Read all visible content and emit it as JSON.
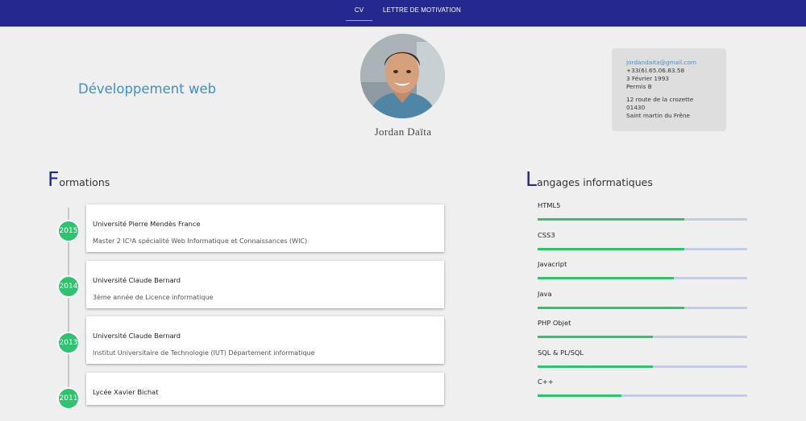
{
  "nav": {
    "cv_label": "CV",
    "lettre_label": "LETTRE DE MOTIVATION"
  },
  "header": {
    "headline": "Développement web",
    "name": "Jordan Daïta"
  },
  "contact": {
    "email": "jordandaita@gmail.com",
    "phone": "+33(6).65.06.83.58",
    "birthdate": "3 Février 1993",
    "license": "Permis B",
    "address_street": "12 route de la crozette",
    "address_zip": "01430",
    "address_city": "Saint martin du Frêne"
  },
  "formations": {
    "title_first": "F",
    "title_rest": "ormations",
    "items": [
      {
        "year": "2015",
        "school": "Université Pierre Mendès France",
        "degree": "Master 2 IC²A spécialité Web Informatique et Connaissances (WIC)"
      },
      {
        "year": "2014",
        "school": "Université Claude Bernard",
        "degree": "3ème année de Licence informatique"
      },
      {
        "year": "2013",
        "school": "Université Claude Bernard",
        "degree": "Institut Universitaire de Technologie (IUT) Département informatique"
      },
      {
        "year": "2011",
        "school": "Lycée Xavier Bichat",
        "degree": ""
      }
    ]
  },
  "langages": {
    "title_first": "L",
    "title_rest": "angages informatiques",
    "items": [
      {
        "label": "HTML5",
        "level": 0.7
      },
      {
        "label": "CSS3",
        "level": 0.7
      },
      {
        "label": "Javacript",
        "level": 0.65
      },
      {
        "label": "Java",
        "level": 0.7
      },
      {
        "label": "PHP Objet",
        "level": 0.55
      },
      {
        "label": "SQL & PL/SQL",
        "level": 0.55
      },
      {
        "label": "C++",
        "level": 0.4
      }
    ]
  },
  "colors": {
    "navbar": "#25288f",
    "accent_green": "#2ec46e",
    "accent_blue": "#3d8fc8",
    "bar_track": "#c3cbe6"
  }
}
